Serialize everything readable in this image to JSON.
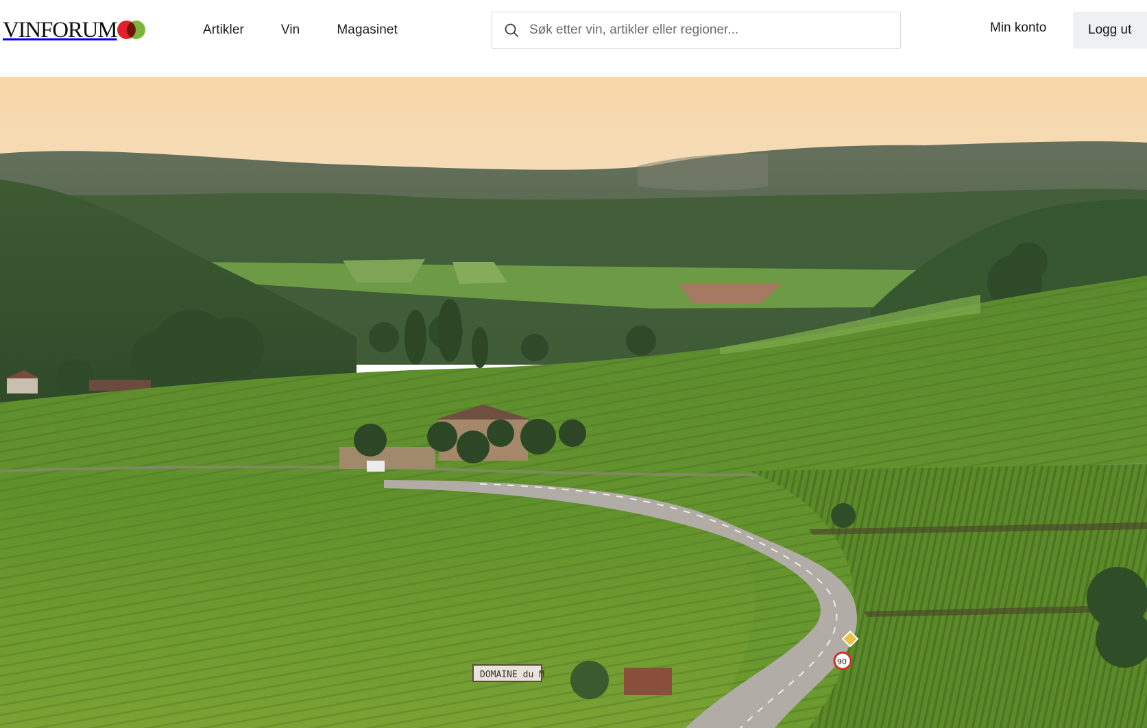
{
  "brand": {
    "name": "VINFORUM",
    "colors": {
      "red": "#e0202b",
      "green": "#7cb53b"
    }
  },
  "nav": {
    "items": [
      {
        "label": "Artikler"
      },
      {
        "label": "Vin"
      },
      {
        "label": "Magasinet"
      }
    ]
  },
  "search": {
    "placeholder": "Søk etter vin, artikler eller regioner...",
    "value": "",
    "icon": "search-icon"
  },
  "account": {
    "my_account_label": "Min konto",
    "logout_label": "Logg ut"
  },
  "hero": {
    "sign_text": "DOMAINE du M",
    "speed_sign": "90"
  }
}
